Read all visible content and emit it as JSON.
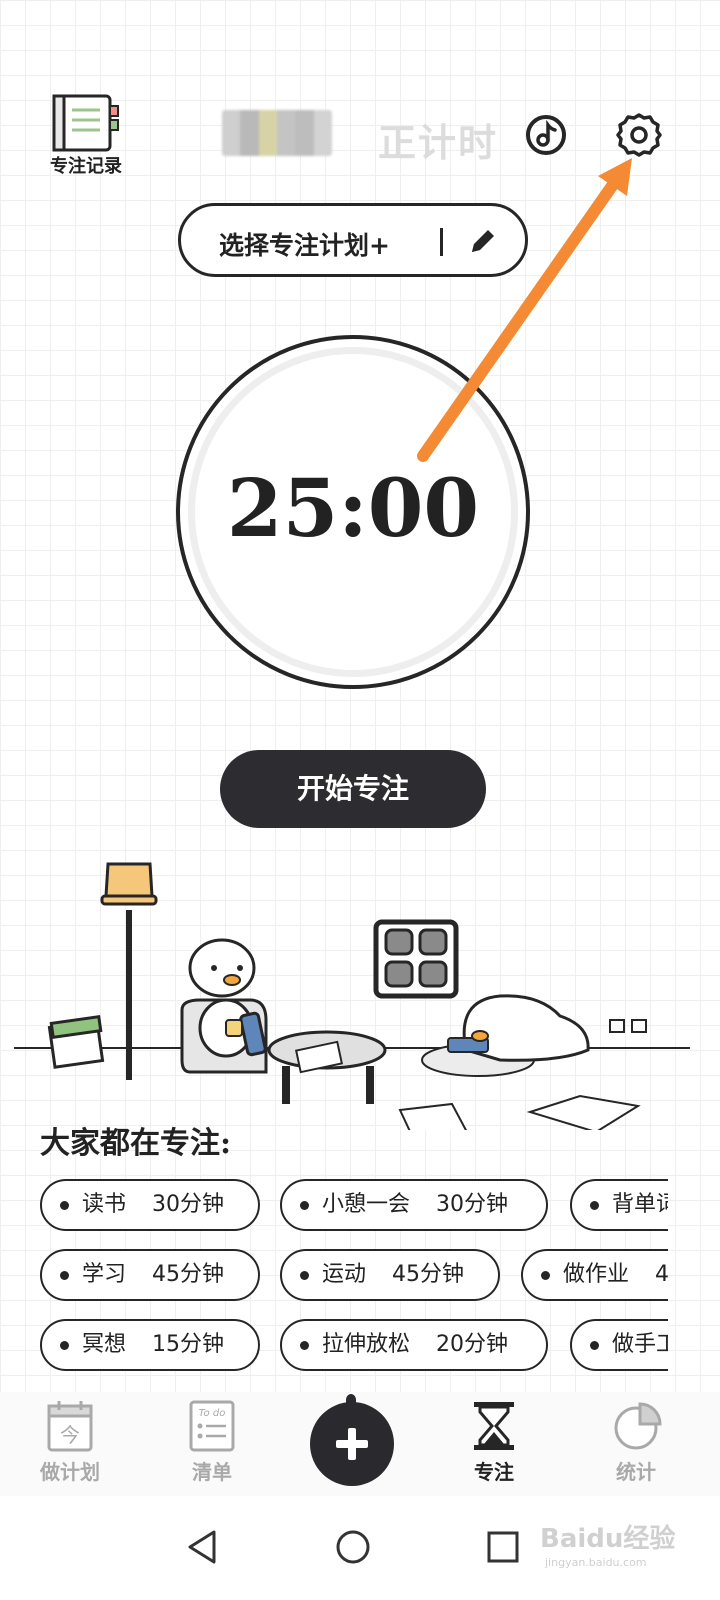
{
  "header": {
    "record_label": "专注记录",
    "mode_title": "正计时",
    "blur_colors": [
      "#cfcfcf",
      "#b9b9b9",
      "#d8d3a6",
      "#c4c4c4",
      "#bdbdbd",
      "#d3d3d3"
    ],
    "music_icon": "music-note-icon",
    "settings_icon": "gear-icon"
  },
  "plan": {
    "label": "选择专注计划+",
    "edit_icon": "pencil-icon"
  },
  "timer": {
    "display": "25:00"
  },
  "start_button": {
    "label": "开始专注"
  },
  "annotation": {
    "arrow_color": "#f58a35"
  },
  "everyone": {
    "title": "大家都在专注:",
    "chips": [
      {
        "name": "读书",
        "duration": "30分钟"
      },
      {
        "name": "小憩一会",
        "duration": "30分钟"
      },
      {
        "name": "背单词",
        "duration": ""
      },
      {
        "name": "学习",
        "duration": "45分钟"
      },
      {
        "name": "运动",
        "duration": "45分钟"
      },
      {
        "name": "做作业",
        "duration": "4"
      },
      {
        "name": "冥想",
        "duration": "15分钟"
      },
      {
        "name": "拉伸放松",
        "duration": "20分钟"
      },
      {
        "name": "做手工",
        "duration": ""
      }
    ]
  },
  "bottom_nav": {
    "items": [
      {
        "label": "做计划",
        "icon": "calendar-icon",
        "active": false
      },
      {
        "label": "清单",
        "icon": "todo-list-icon",
        "active": false
      },
      {
        "label": "",
        "icon": "plus-icon",
        "active": false
      },
      {
        "label": "专注",
        "icon": "hourglass-icon",
        "active": true
      },
      {
        "label": "统计",
        "icon": "pie-chart-icon",
        "active": false
      }
    ],
    "calendar_glyph": "今",
    "todo_glyph": "To do"
  },
  "system_nav": {
    "back_icon": "back-triangle-icon",
    "home_icon": "home-circle-icon",
    "recents_icon": "recents-square-icon"
  },
  "watermark": {
    "text": "Baidu经验",
    "sub": "jingyan.baidu.com"
  }
}
